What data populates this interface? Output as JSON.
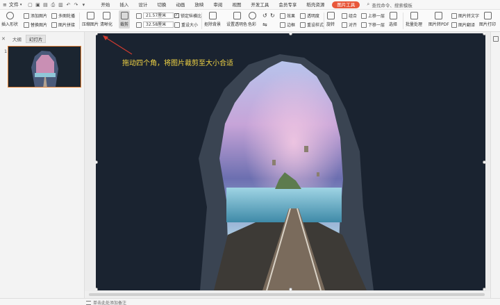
{
  "topbar": {
    "file_menu": "文件",
    "tabs": [
      "开始",
      "插入",
      "设计",
      "切换",
      "动画",
      "放映",
      "审阅",
      "视图",
      "开发工具",
      "会员专享",
      "稻壳资源",
      "图片工具"
    ],
    "active_tab": "图片工具",
    "search_placeholder": "查找命令、搜索模板"
  },
  "ribbon": {
    "insert_shape": "插入形状",
    "add_picture": "添加图片",
    "replace_picture": "替换图片",
    "multi_picture": "多图轮播",
    "picture_split": "图片拼接",
    "compress": "压缩图片",
    "clarity": "清晰化",
    "crop": "裁剪",
    "width_value": "21.57厘米",
    "height_value": "32.58厘米",
    "lock_ratio": "锁定纵横比",
    "reset_size": "重设大小",
    "remove_bg": "抠除背景",
    "set_transparent": "设置透明色",
    "color": "色彩",
    "effects": "效果",
    "transparency": "透明度",
    "border": "边框",
    "reset_style": "重设样式",
    "rotate": "旋转",
    "combine": "组合",
    "align": "对齐",
    "bring_forward": "上移一层",
    "send_backward": "下移一层",
    "select": "选择",
    "batch": "批量处理",
    "to_pdf": "图片转PDF",
    "to_text": "图片转文字",
    "translate": "图片翻译",
    "print": "图片打印"
  },
  "left_panel": {
    "tab_outline": "大纲",
    "tab_slides": "幻灯片",
    "slide_number": "1"
  },
  "annotation": {
    "text": "拖动四个角，将图片裁剪至大小合适"
  },
  "statusbar": {
    "notes": "单击此处添加备注"
  },
  "colors": {
    "accent": "#e8573a",
    "annotation": "#f2d445",
    "thumb_border": "#e8863a"
  }
}
